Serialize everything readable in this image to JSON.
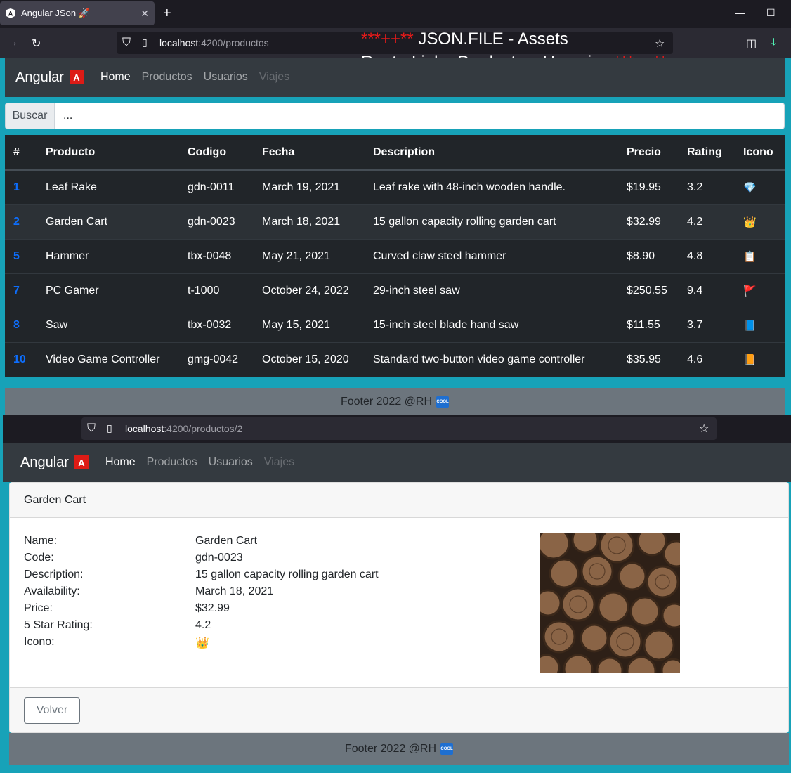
{
  "browser": {
    "tab_title": "Angular JSon 🚀",
    "url1_host": "localhost",
    "url1_path": ":4200/productos",
    "url2_host": "localhost",
    "url2_path": ":4200/productos/2"
  },
  "overlay": {
    "line1_stars": "***++**",
    "line1_text": " JSON.FILE - Assets",
    "line2_text": "RouterLink - Productos, Usuarios ",
    "line2_stars": "***++**"
  },
  "nav": {
    "brand": "Angular",
    "brand_logo": "A",
    "links": [
      "Home",
      "Productos",
      "Usuarios",
      "Viajes"
    ]
  },
  "search": {
    "label": "Buscar",
    "value": "..."
  },
  "table": {
    "headers": [
      "#",
      "Producto",
      "Codigo",
      "Fecha",
      "Description",
      "Precio",
      "Rating",
      "Icono"
    ],
    "rows": [
      [
        "1",
        "Leaf Rake",
        "gdn-0011",
        "March 19, 2021",
        "Leaf rake with 48-inch wooden handle.",
        "$19.95",
        "3.2",
        "💎"
      ],
      [
        "2",
        "Garden Cart",
        "gdn-0023",
        "March 18, 2021",
        "15 gallon capacity rolling garden cart",
        "$32.99",
        "4.2",
        "👑"
      ],
      [
        "5",
        "Hammer",
        "tbx-0048",
        "May 21, 2021",
        "Curved claw steel hammer",
        "$8.90",
        "4.8",
        "📋"
      ],
      [
        "7",
        "PC Gamer",
        "t-1000",
        "October 24, 2022",
        "29-inch steel saw",
        "$250.55",
        "9.4",
        "🚩"
      ],
      [
        "8",
        "Saw",
        "tbx-0032",
        "May 15, 2021",
        "15-inch steel blade hand saw",
        "$11.55",
        "3.7",
        "📘"
      ],
      [
        "10",
        "Video Game Controller",
        "gmg-0042",
        "October 15, 2020",
        "Standard two-button video game controller",
        "$35.95",
        "4.6",
        "📙"
      ]
    ]
  },
  "footer": {
    "text": "Footer 2022 @RH",
    "badge": "COOL"
  },
  "detail": {
    "header": "Garden Cart",
    "fields": [
      {
        "label": "Name:",
        "value": "Garden Cart"
      },
      {
        "label": "Code:",
        "value": "gdn-0023"
      },
      {
        "label": "Description:",
        "value": "15 gallon capacity rolling garden cart"
      },
      {
        "label": "Availability:",
        "value": "March 18, 2021"
      },
      {
        "label": "Price:",
        "value": "$32.99"
      },
      {
        "label": "5 Star Rating:",
        "value": "4.2"
      },
      {
        "label": "Icono:",
        "value": "👑"
      }
    ],
    "back_button": "Volver"
  },
  "colors": {
    "page_bg": "#17a2b8",
    "navbar": "#343a40",
    "table_bg": "#212529",
    "footer": "#6c757d",
    "link_blue": "#0d6efd"
  }
}
